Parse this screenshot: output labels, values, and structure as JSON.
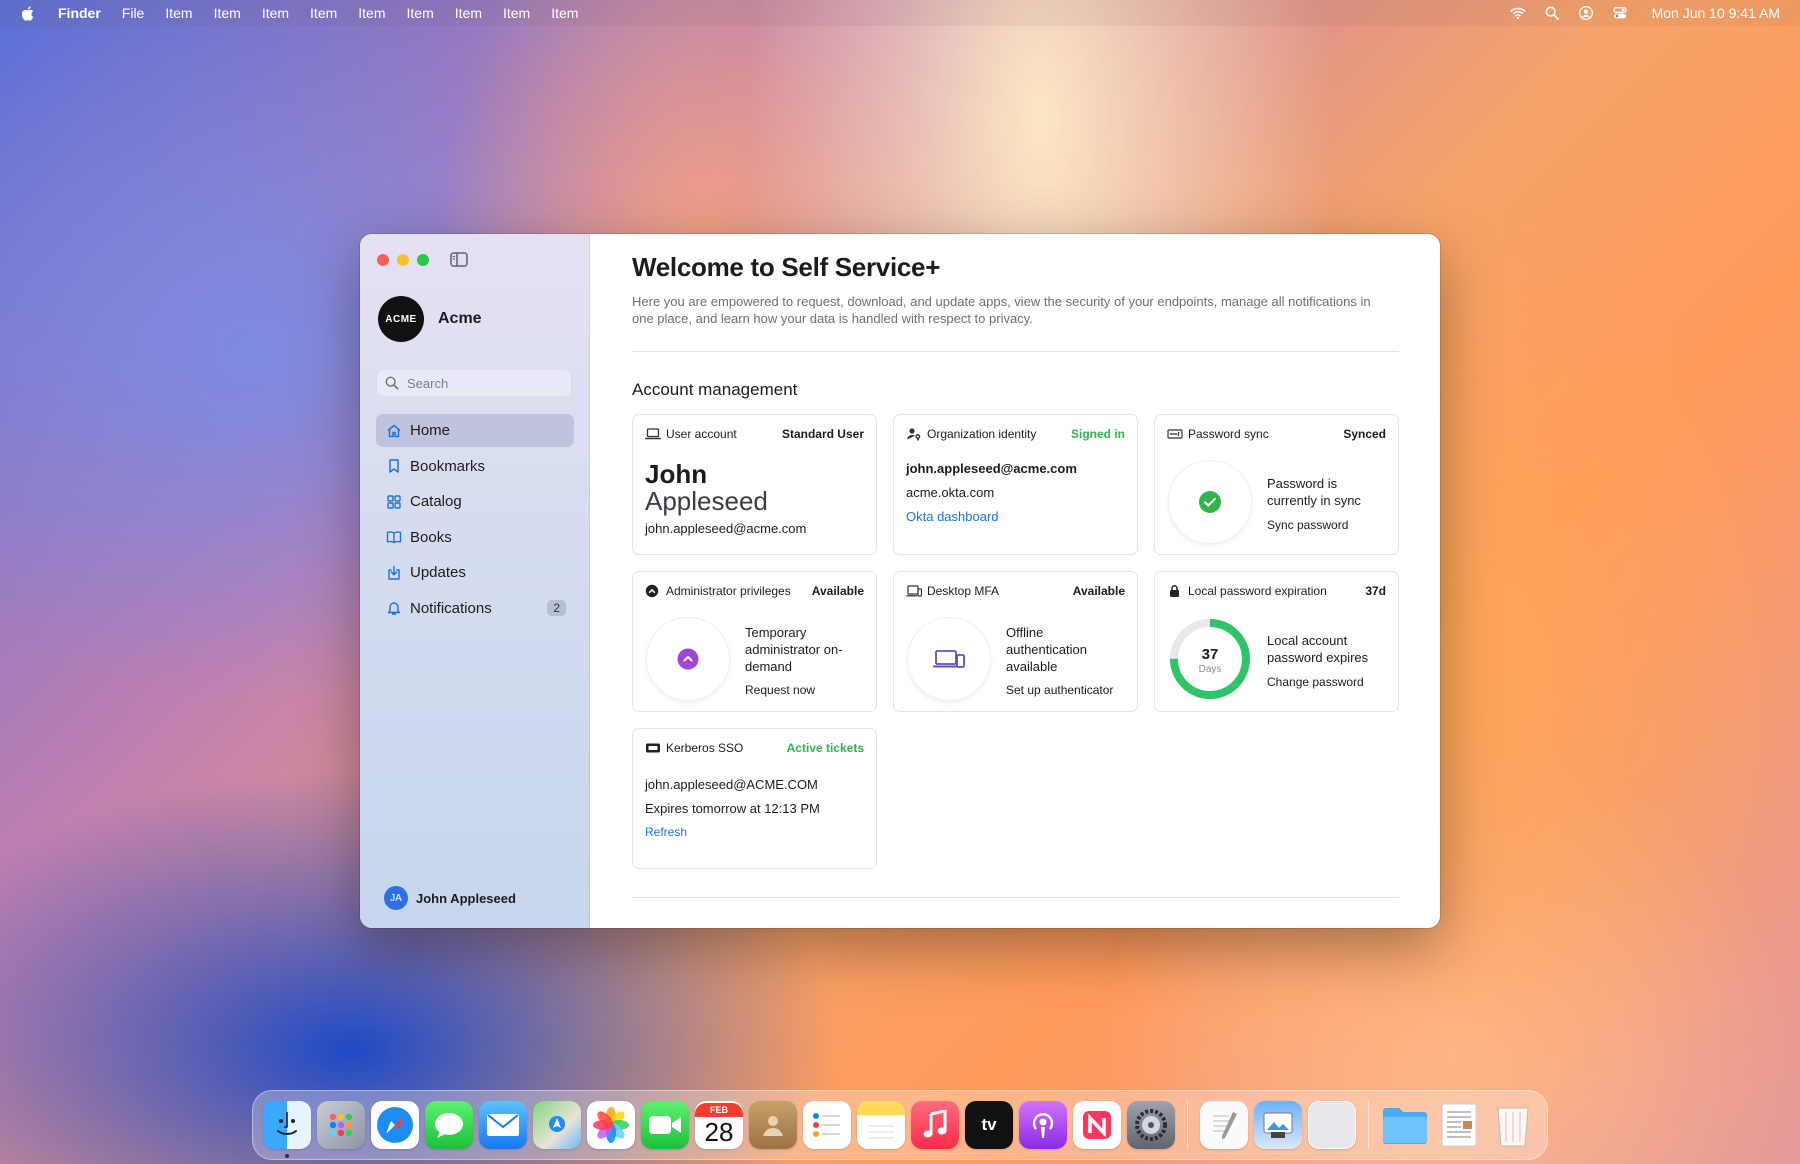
{
  "menubar": {
    "app": "Finder",
    "items": [
      "File",
      "Item",
      "Item",
      "Item",
      "Item",
      "Item",
      "Item",
      "Item",
      "Item",
      "Item"
    ],
    "clock": "Mon Jun 10  9:41 AM"
  },
  "sidebar": {
    "org_logo": "ACME",
    "org_name": "Acme",
    "search_placeholder": "Search",
    "items": [
      {
        "label": "Home",
        "icon": "house-icon"
      },
      {
        "label": "Bookmarks",
        "icon": "bookmark-icon"
      },
      {
        "label": "Catalog",
        "icon": "grid-icon"
      },
      {
        "label": "Books",
        "icon": "book-icon"
      },
      {
        "label": "Updates",
        "icon": "download-icon"
      },
      {
        "label": "Notifications",
        "icon": "bell-icon",
        "badge": "2"
      }
    ],
    "user_initials": "JA",
    "user_name": "John Appleseed"
  },
  "main": {
    "title": "Welcome to Self Service+",
    "intro": "Here you are empowered to request, download, and update apps, view the security of your endpoints, manage all notifications in one place, and learn how your data is handled with respect to privacy.",
    "section_title": "Account management",
    "cards": {
      "user_account": {
        "title": "User account",
        "status": "Standard User",
        "first_name": "John",
        "last_name": "Appleseed",
        "email": "john.appleseed@acme.com"
      },
      "org_identity": {
        "title": "Organization identity",
        "status": "Signed in",
        "email": "john.appleseed@acme.com",
        "domain": "acme.okta.com",
        "link": "Okta dashboard"
      },
      "password_sync": {
        "title": "Password sync",
        "status": "Synced",
        "text": "Password is currently in sync",
        "link": "Sync password"
      },
      "admin_privileges": {
        "title": "Administrator privileges",
        "status": "Available",
        "text": "Temporary administrator on-demand",
        "link": "Request now"
      },
      "desktop_mfa": {
        "title": "Desktop MFA",
        "status": "Available",
        "text": "Offline authentication available",
        "link": "Set up authenticator"
      },
      "local_password": {
        "title": "Local password expiration",
        "status": "37d",
        "days_number": "37",
        "days_label": "Days",
        "remaining_fraction": 0.75,
        "text": "Local account password expires",
        "link": "Change password"
      },
      "kerberos": {
        "title": "Kerberos SSO",
        "status": "Active tickets",
        "principal": "john.appleseed@ACME.COM",
        "expiry": "Expires tomorrow at 12:13 PM",
        "link": "Refresh"
      }
    }
  },
  "dock": {
    "calendar_month": "FEB",
    "calendar_day": "28",
    "tv_label": "tv"
  },
  "colors": {
    "accent": "#1a73d9",
    "success": "#2fb54a",
    "admin_purple": "#a046d8"
  }
}
